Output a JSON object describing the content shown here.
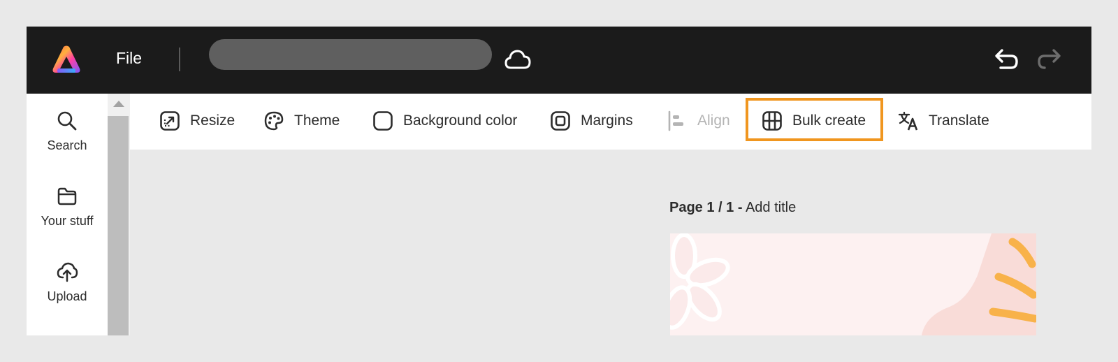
{
  "header": {
    "file_label": "File",
    "doc_title_value": "",
    "colors": {
      "bar": "#1b1b1b",
      "title_field": "#5f5f5f"
    },
    "icons": [
      "adobe-express-logo-icon",
      "cloud-icon",
      "undo-icon",
      "redo-icon"
    ]
  },
  "leftrail": {
    "items": [
      {
        "label": "Search",
        "icon": "search-icon"
      },
      {
        "label": "Your stuff",
        "icon": "folder-icon"
      },
      {
        "label": "Upload",
        "icon": "upload-cloud-icon"
      }
    ]
  },
  "toolbar": {
    "items": [
      {
        "label": "Resize",
        "icon": "resize-icon",
        "enabled": true
      },
      {
        "label": "Theme",
        "icon": "palette-icon",
        "enabled": true
      },
      {
        "label": "Background color",
        "icon": "square-icon",
        "enabled": true
      },
      {
        "label": "Margins",
        "icon": "margins-icon",
        "enabled": true
      },
      {
        "label": "Align",
        "icon": "align-icon",
        "enabled": false
      },
      {
        "label": "Bulk create",
        "icon": "grid-icon",
        "enabled": true,
        "highlighted": true
      },
      {
        "label": "Translate",
        "icon": "translate-icon",
        "enabled": true
      }
    ],
    "highlight_color": "#f0961f"
  },
  "canvas": {
    "page_indicator": "Page 1 / 1 -",
    "page_title_placeholder": "Add title",
    "preview_colors": {
      "background": "#fdf1f1",
      "blob": "#f9dcd8",
      "accent": "#f8b24a"
    }
  }
}
